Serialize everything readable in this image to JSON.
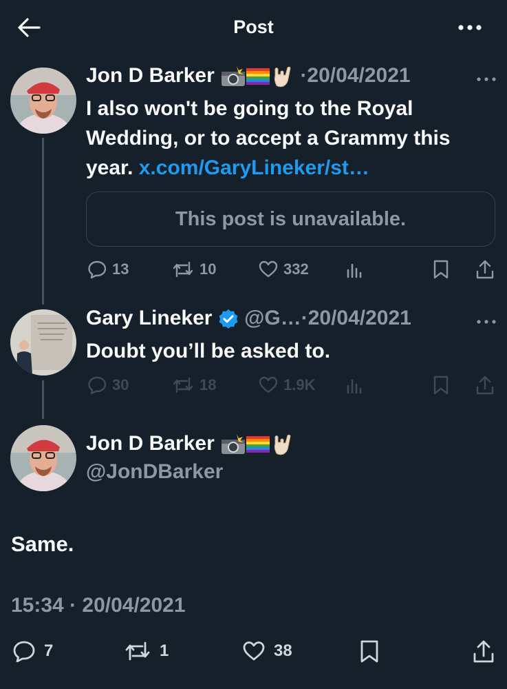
{
  "header": {
    "title": "Post"
  },
  "thread": [
    {
      "name": "Jon D Barker",
      "timestamp": "·20/04/2021",
      "text_before_link": "I also won't be going to the Royal Wedding, or to accept a Grammy this year. ",
      "link": "x.com/GaryLineker/st…",
      "quote": "This post is unavailable.",
      "replies": "13",
      "reposts": "10",
      "likes": "332"
    },
    {
      "name": "Gary Lineker",
      "handle": "@G…",
      "timestamp": "·20/04/2021",
      "text": "Doubt you’ll be asked to.",
      "replies": "30",
      "reposts": "18",
      "likes": "1.9K"
    }
  ],
  "main_post": {
    "name": "Jon D Barker",
    "handle": "@JonDBarker",
    "text": "Same.",
    "time": "15:34 · 20/04/2021",
    "replies": "7",
    "reposts": "1",
    "likes": "38"
  },
  "icons": [
    "back-arrow-icon",
    "more-icon",
    "camera-flash-icon",
    "rainbow-flag-icon",
    "rock-hand-icon",
    "verified-badge-icon",
    "reply-icon",
    "repost-icon",
    "like-icon",
    "views-icon",
    "bookmark-icon",
    "share-icon"
  ],
  "colors": {
    "background": "#15202b",
    "text": "#e7e9ea",
    "muted": "#8b98a5",
    "link": "#1d9bf0",
    "border": "#38444d"
  }
}
